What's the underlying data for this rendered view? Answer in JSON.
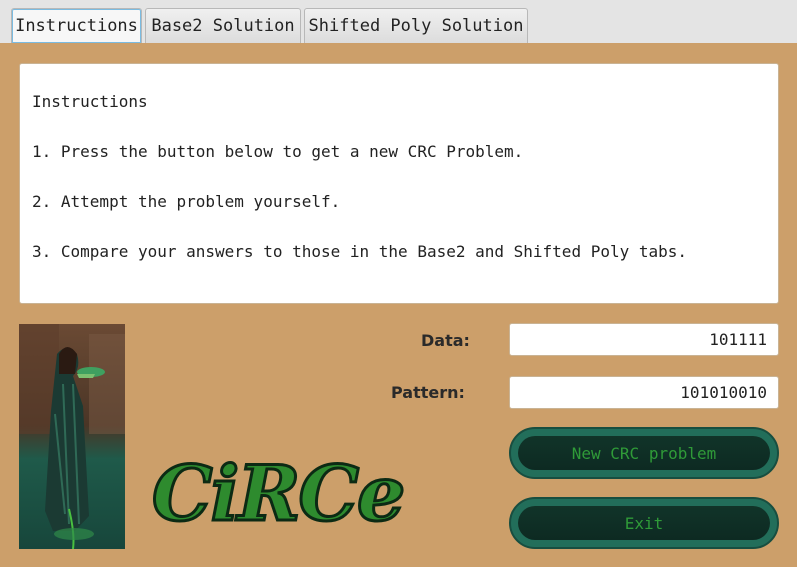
{
  "tabs": [
    {
      "label": "Instructions",
      "active": true
    },
    {
      "label": "Base2 Solution",
      "active": false
    },
    {
      "label": "Shifted Poly Solution",
      "active": false
    }
  ],
  "instructions": {
    "lines": [
      "Instructions",
      "1. Press the button below to get a new CRC Problem.",
      "2. Attempt the problem yourself.",
      "3. Compare your answers to those in the Base2 and Shifted Poly tabs."
    ]
  },
  "form": {
    "data_label": "Data:",
    "data_value": "101111",
    "pattern_label": "Pattern:",
    "pattern_value": "101010010"
  },
  "buttons": {
    "new_problem": "New CRC problem",
    "exit": "Exit"
  },
  "logo": {
    "text": "CiRCe"
  },
  "colors": {
    "background": "#cc9f6a",
    "button_fill": "#226e5a",
    "button_text": "#2f9a38",
    "logo_fill": "#2e8b2e"
  }
}
